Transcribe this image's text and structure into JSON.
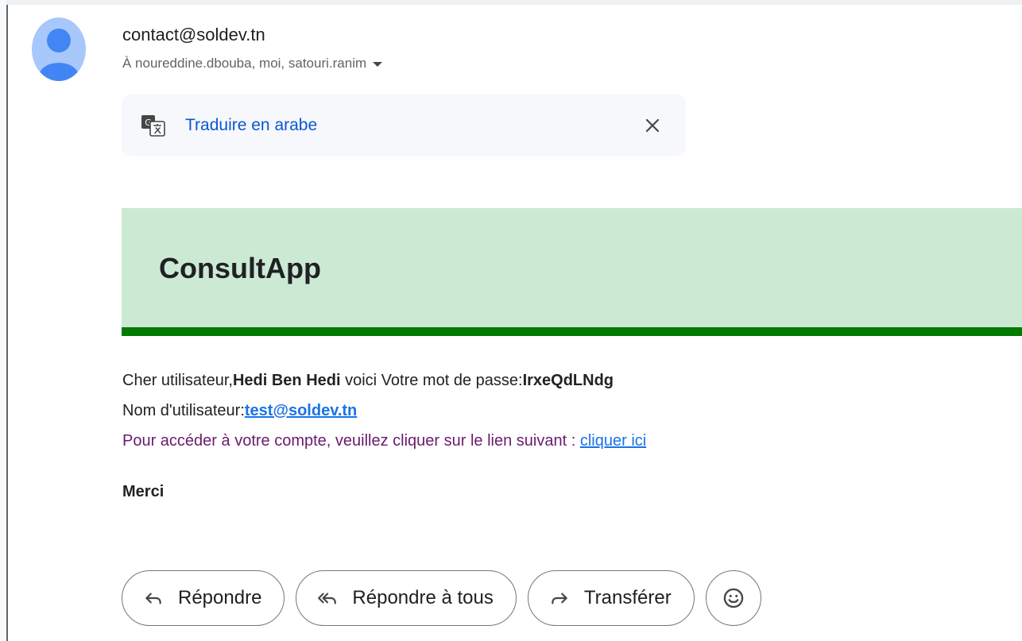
{
  "message": {
    "sender": "contact@soldev.tn",
    "recipients": "À noureddine.dbouba, moi, satouri.ranim"
  },
  "translate_bar": {
    "link_label": "Traduire en arabe"
  },
  "email_body": {
    "brand": "ConsultApp",
    "line1": {
      "prefix": "Cher utilisateur,",
      "name": "Hedi Ben Hedi",
      "middle": " voici Votre mot de passe:",
      "password": "IrxeQdLNdg"
    },
    "line2": {
      "prefix": "Nom d'utilisateur:",
      "username": "test@soldev.tn"
    },
    "line3": {
      "prefix": "Pour accéder à votre compte, veuillez cliquer sur le lien suivant : ",
      "link_text": "cliquer ici"
    },
    "closing": "Merci"
  },
  "actions": {
    "reply_label": "Répondre",
    "reply_all_label": "Répondre à tous",
    "forward_label": "Transférer"
  },
  "colors": {
    "avatar_bg": "#a8c7fa",
    "avatar_fg": "#4285f4",
    "link_blue": "#0b57d0",
    "header_band": "#cce9d4",
    "header_bar": "#007a00",
    "purple_text": "#6a1b6d"
  },
  "icons": {
    "avatar": "person-avatar-icon",
    "dropdown": "triangle-down-icon",
    "translate": "translate-icon",
    "close": "close-icon",
    "reply": "reply-icon",
    "reply_all": "reply-all-icon",
    "forward": "forward-icon",
    "emoji": "emoji-icon"
  }
}
